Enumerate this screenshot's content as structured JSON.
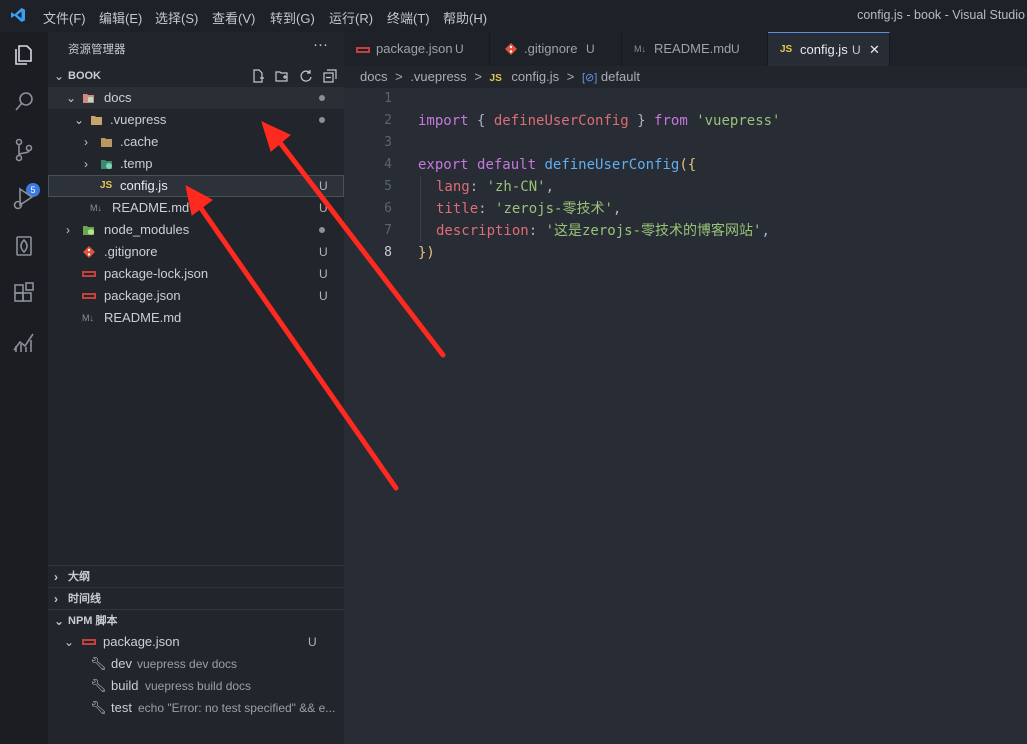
{
  "titlebar": {
    "menus": [
      "文件(F)",
      "编辑(E)",
      "选择(S)",
      "查看(V)",
      "转到(G)",
      "运行(R)",
      "终端(T)",
      "帮助(H)"
    ],
    "window_title": "config.js - book - Visual Studio"
  },
  "activity": {
    "scm_badge": "5",
    "icons": [
      "explorer-icon",
      "search-icon",
      "source-control-icon",
      "run-debug-icon",
      "extension-leaf-icon",
      "extensions-icon",
      "analytics-icon"
    ]
  },
  "sidebar": {
    "title": "资源管理器",
    "more": "···",
    "workspace": "BOOK",
    "tree": [
      {
        "label": "docs",
        "status": "dot"
      },
      {
        "label": ".vuepress",
        "status": "dot"
      },
      {
        "label": ".cache",
        "status": ""
      },
      {
        "label": ".temp",
        "status": ""
      },
      {
        "label": "config.js",
        "status": "U"
      },
      {
        "label": "README.md",
        "status": "U"
      },
      {
        "label": "node_modules",
        "status": "dot"
      },
      {
        "label": ".gitignore",
        "status": "U"
      },
      {
        "label": "package-lock.json",
        "status": "U"
      },
      {
        "label": "package.json",
        "status": "U"
      },
      {
        "label": "README.md",
        "status": ""
      }
    ],
    "sections": {
      "outline": "大纲",
      "timeline": "时间线",
      "npm": "NPM 脚本"
    },
    "npm": {
      "file": "package.json",
      "file_status": "U",
      "scripts": [
        {
          "name": "dev",
          "cmd": "vuepress dev docs"
        },
        {
          "name": "build",
          "cmd": "vuepress build docs"
        },
        {
          "name": "test",
          "cmd": "echo \"Error: no test specified\" && e..."
        }
      ]
    }
  },
  "tabs": [
    {
      "label": "package.json",
      "status": "U"
    },
    {
      "label": ".gitignore",
      "status": "U"
    },
    {
      "label": "README.md",
      "status": "U"
    },
    {
      "label": "config.js",
      "status": "U",
      "close": "✕"
    }
  ],
  "breadcrumb": {
    "parts": [
      "docs",
      ".vuepress",
      "config.js",
      "default"
    ],
    "js_badge": "JS",
    "sep": ">"
  },
  "editor": {
    "line_numbers": [
      "1",
      "2",
      "3",
      "4",
      "5",
      "6",
      "7",
      "8"
    ],
    "code": {
      "l2": {
        "import": "import",
        "open": " { ",
        "name": "defineUserConfig",
        "close": " } ",
        "from": "from",
        "sp": " ",
        "mod": "'vuepress'"
      },
      "l4": {
        "export": "export",
        "sp1": " ",
        "default": "default",
        "sp2": " ",
        "fn": "defineUserConfig",
        "open": "({"
      },
      "l5": {
        "key": "lang",
        "colon": ": ",
        "val": "'zh-CN'",
        "comma": ","
      },
      "l6": {
        "key": "title",
        "colon": ": ",
        "val": "'zerojs-零技术'",
        "comma": ","
      },
      "l7": {
        "key": "description",
        "colon": ": ",
        "val": "'这是zerojs-零技术的博客网站'",
        "comma": ","
      },
      "l8": {
        "close": "})"
      }
    }
  },
  "file_icon_labels": {
    "js": "JS",
    "md": "M↓"
  },
  "colors": {
    "accent": "#3b7ae0",
    "arrow": "#ff2a1f",
    "keyword": "#c678dd",
    "string": "#98c379"
  }
}
